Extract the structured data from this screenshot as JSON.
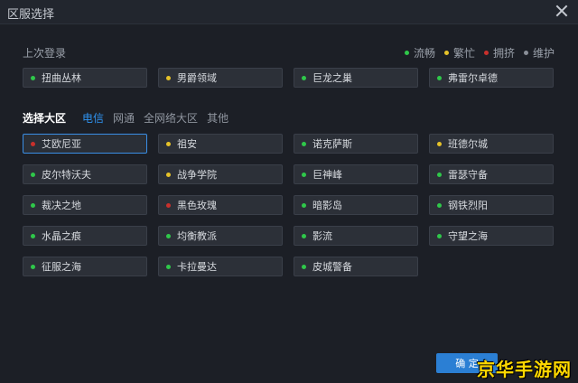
{
  "window": {
    "title": "区服选择"
  },
  "colors": {
    "smooth": "#2fc84a",
    "busy": "#e6c229",
    "crowded": "#c9302c",
    "maintenance": "#8a8f98",
    "accent": "#2f93f0"
  },
  "recent": {
    "label": "上次登录"
  },
  "legend": [
    {
      "label": "流畅",
      "status": "smooth"
    },
    {
      "label": "繁忙",
      "status": "busy"
    },
    {
      "label": "拥挤",
      "status": "crowded"
    },
    {
      "label": "维护",
      "status": "maintenance"
    }
  ],
  "recent_servers": [
    {
      "name": "扭曲丛林",
      "status": "smooth"
    },
    {
      "name": "男爵领域",
      "status": "busy"
    },
    {
      "name": "巨龙之巢",
      "status": "smooth"
    },
    {
      "name": "弗雷尔卓德",
      "status": "smooth"
    }
  ],
  "region": {
    "heading": "选择大区",
    "tabs": [
      "电信",
      "网通",
      "全网络大区",
      "其他"
    ],
    "active_tab": 0
  },
  "servers": [
    {
      "name": "艾欧尼亚",
      "status": "crowded",
      "selected": true
    },
    {
      "name": "祖安",
      "status": "busy"
    },
    {
      "name": "诺克萨斯",
      "status": "smooth"
    },
    {
      "name": "班德尔城",
      "status": "busy"
    },
    {
      "name": "皮尔特沃夫",
      "status": "smooth"
    },
    {
      "name": "战争学院",
      "status": "busy"
    },
    {
      "name": "巨神峰",
      "status": "smooth"
    },
    {
      "name": "雷瑟守备",
      "status": "smooth"
    },
    {
      "name": "裁决之地",
      "status": "smooth"
    },
    {
      "name": "黑色玫瑰",
      "status": "crowded"
    },
    {
      "name": "暗影岛",
      "status": "smooth"
    },
    {
      "name": "钢铁烈阳",
      "status": "smooth"
    },
    {
      "name": "水晶之痕",
      "status": "smooth"
    },
    {
      "name": "均衡教派",
      "status": "smooth"
    },
    {
      "name": "影流",
      "status": "smooth"
    },
    {
      "name": "守望之海",
      "status": "smooth"
    },
    {
      "name": "征服之海",
      "status": "smooth"
    },
    {
      "name": "卡拉曼达",
      "status": "smooth"
    },
    {
      "name": "皮城警备",
      "status": "smooth"
    }
  ],
  "actions": {
    "confirm_label": "确 定"
  },
  "watermark": {
    "text": "京华手游网"
  }
}
